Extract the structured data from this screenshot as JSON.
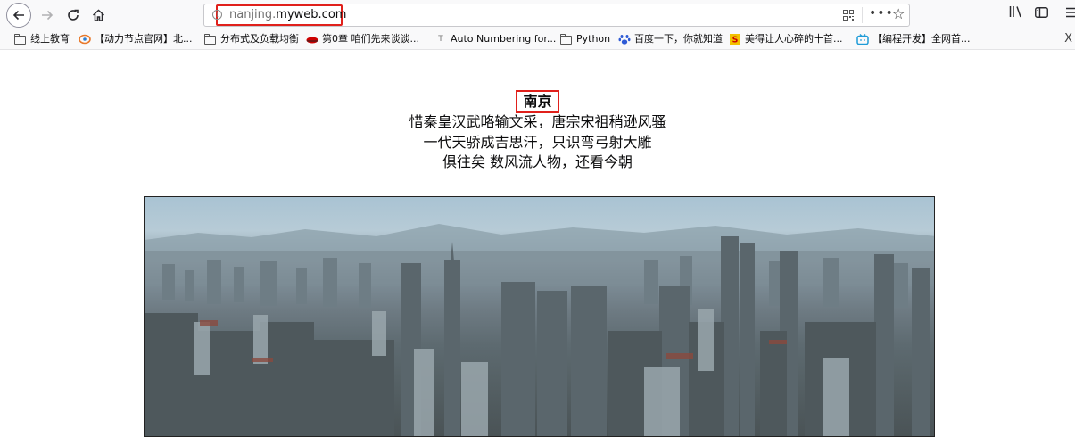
{
  "browser": {
    "url_prefix": "nanjing.",
    "url_domain": "myweb.com",
    "info_glyph": "i",
    "more_glyph": "•••",
    "star_glyph": "☆",
    "close_glyph": "X",
    "highlight_color": "#e0201b"
  },
  "bookmarks": [
    {
      "label": "线上教育",
      "icon": "folder-icon"
    },
    {
      "label": "【动力节点官网】北...",
      "icon": "site-logo-icon"
    },
    {
      "label": "分布式及负载均衡",
      "icon": "folder-icon"
    },
    {
      "label": "第0章 咱们先来谈谈...",
      "icon": "redhat-icon"
    },
    {
      "label": "Auto Numbering for...",
      "icon": "t-icon"
    },
    {
      "label": "Python",
      "icon": "folder-icon"
    },
    {
      "label": "百度一下，你就知道",
      "icon": "baidu-paw-icon"
    },
    {
      "label": "美得让人心碎的十首...",
      "icon": "s-logo-icon"
    },
    {
      "label": "【编程开发】全网首...",
      "icon": "bilibili-icon"
    }
  ],
  "page": {
    "title": "南京",
    "poem": [
      "惜秦皇汉武略输文采，唐宗宋祖稍逊风骚",
      "一代天骄成吉思汗，只识弯弓射大雕",
      "俱往矣 数风流人物，还看今朝"
    ]
  }
}
